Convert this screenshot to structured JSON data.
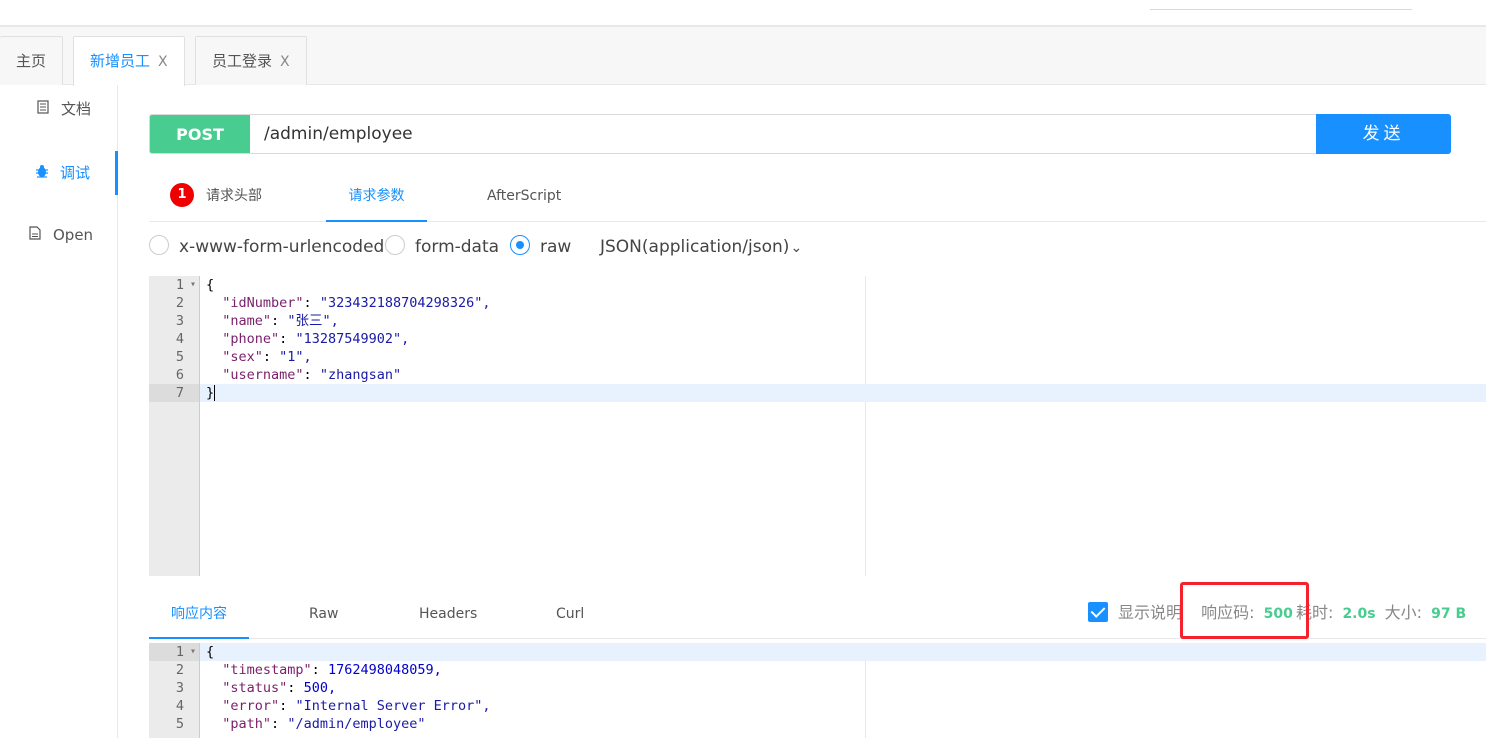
{
  "page_tabs": [
    {
      "label": "主页"
    },
    {
      "label": "新增员工",
      "close": "X"
    },
    {
      "label": "员工登录",
      "close": "X"
    }
  ],
  "sidebar": {
    "items": [
      {
        "label": "文档",
        "icon": "document-icon"
      },
      {
        "label": "调试",
        "icon": "bug-icon"
      },
      {
        "label": "Open",
        "icon": "file-icon"
      }
    ]
  },
  "request": {
    "method": "POST",
    "url": "/admin/employee",
    "send_label": "发送"
  },
  "request_tabs": {
    "headers_badge": "1",
    "headers": "请求头部",
    "params": "请求参数",
    "after_script": "AfterScript"
  },
  "body_types": {
    "urlencoded": "x-www-form-urlencoded",
    "form_data": "form-data",
    "raw": "raw",
    "selected": "raw",
    "content_type": "JSON(application/json)"
  },
  "request_body": {
    "line_numbers": [
      "1",
      "2",
      "3",
      "4",
      "5",
      "6",
      "7"
    ],
    "open_brace": "{",
    "close_brace": "}",
    "fields": [
      {
        "key": "\"idNumber\"",
        "value": "\"323432188704298326\","
      },
      {
        "key": "\"name\"",
        "value": "\"张三\","
      },
      {
        "key": "\"phone\"",
        "value": "\"13287549902\","
      },
      {
        "key": "\"sex\"",
        "value": "\"1\","
      },
      {
        "key": "\"username\"",
        "value": "\"zhangsan\""
      }
    ]
  },
  "response_tabs": {
    "content": "响应内容",
    "raw": "Raw",
    "headers": "Headers",
    "curl": "Curl"
  },
  "response_info": {
    "show_desc": "显示说明",
    "code_label": "响应码:",
    "code_value": "500",
    "time_label": "耗时:",
    "time_value": "2.0s",
    "size_label": "大小:",
    "size_value": "97 B"
  },
  "response_body": {
    "line_numbers": [
      "1",
      "2",
      "3",
      "4",
      "5"
    ],
    "open_brace": "{",
    "fields": [
      {
        "key": "\"timestamp\"",
        "value": "1762498048059,",
        "kind": "number"
      },
      {
        "key": "\"status\"",
        "value": "500,",
        "kind": "number"
      },
      {
        "key": "\"error\"",
        "value": "\"Internal Server Error\",",
        "kind": "string"
      },
      {
        "key": "\"path\"",
        "value": "\"/admin/employee\"",
        "kind": "string"
      }
    ]
  }
}
